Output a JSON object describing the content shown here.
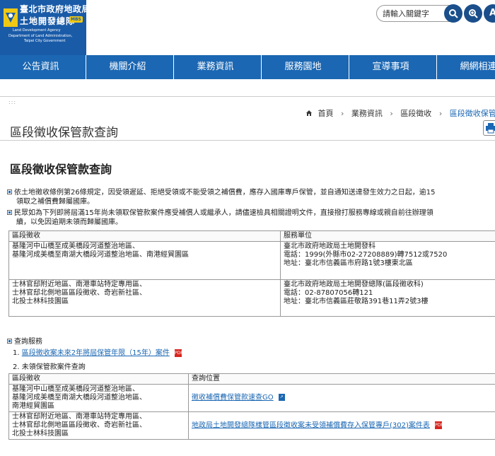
{
  "header": {
    "logo_title_line1": "臺北市政府地政局",
    "logo_title_line2": "土地開發總隊",
    "logo_mini_badge": "MBS",
    "logo_en_line1": "Land Development Agency",
    "logo_en_line2": "Department of Land Administration,",
    "logo_en_line3": "Taipei City Government",
    "search_placeholder": "請輸入關鍵字",
    "search_icon": "search-icon",
    "advanced_search_icon": "zoom-search-icon",
    "accessibility_label": "A"
  },
  "nav": {
    "items": [
      {
        "label": "公告資訊"
      },
      {
        "label": "機關介紹"
      },
      {
        "label": "業務資訊"
      },
      {
        "label": "服務園地"
      },
      {
        "label": "宣導事項"
      },
      {
        "label": "網網相連"
      }
    ]
  },
  "breadcrumb": {
    "home": "首頁",
    "level1": "業務資訊",
    "level2": "區段徵收",
    "current": "區段徵收保管款查詢"
  },
  "page": {
    "title": "區段徵收保管款查詢",
    "section_title": "區段徵收保管款查詢",
    "para1_line1": "依土地徵收條例第26條規定，因受領遲延、拒絕受領或不能受領之補償費，應存入國庫專戶保管，並自通知送達發生效力之日起，逾15",
    "para1_line2": "領取之補償費歸屬國庫。",
    "para2_line1": "民眾如為下列即將屆滿15年尚未領取保管款案件應受補償人或繼承人，請儘速檢具相關證明文件，直接撥打服務專線或親自前往辦理領",
    "para2_line2": "續，以免因逾期未領而歸屬國庫。"
  },
  "table1": {
    "headers": [
      "區段徵收",
      "服務單位"
    ],
    "rows": [
      {
        "area": [
          "基隆河中山橋至成美橋段河道整治地區、",
          "基隆河成美橋至南湖大橋段河道整治地區、南港經貿園區"
        ],
        "unit": [
          "臺北市政府地政局土地開發科",
          "電話：1999(外縣市02-27208889)轉7512或7520",
          "地址：臺北市信義區市府路1號3樓東北區"
        ]
      },
      {
        "area": [
          "士林官邸附近地區、南港車站特定專用區、",
          "士林官邸北側地區區段徵收、奇岩新社區、",
          "北投士林科技園區"
        ],
        "unit": [
          "臺北市政府地政局土地開發總隊(區段徵收科)",
          "電話：02-87807056轉121",
          "地址：臺北市信義區莊敬路391巷11弄2號3樓"
        ]
      }
    ]
  },
  "services": {
    "title": "查詢服務",
    "item1_number": "1.",
    "item1_link": "區段徵收案未來2年將屆保管年限（15年）案件",
    "item1_icon": "pdf-icon",
    "item2": "2. 未領保管款案件查詢"
  },
  "table2": {
    "headers": [
      "區段徵收",
      "查詢位置"
    ],
    "rows": [
      {
        "area": [
          "基隆河中山橋至成美橋段河道整治地區、",
          "基隆河成美橋至南湖大橋段河道整治地區、",
          "南港經貿園區"
        ],
        "link": "徵收補償費保管款速查GO",
        "icon": "link-icon"
      },
      {
        "area": [
          "士林官邸附近地區、南港車站特定專用區、",
          "士林官邸北側地區區段徵收、奇岩新社區、",
          "北投士林科技園區"
        ],
        "link": "地政局土地開發總隊樣管區段徵收案未受領補償費存入保管專戶(302)案件表",
        "icon": "pdf-icon"
      }
    ]
  },
  "colors": {
    "brand_blue": "#1b67b3",
    "logo_blue": "#1a5ba8",
    "pdf_red": "#d7261e"
  }
}
